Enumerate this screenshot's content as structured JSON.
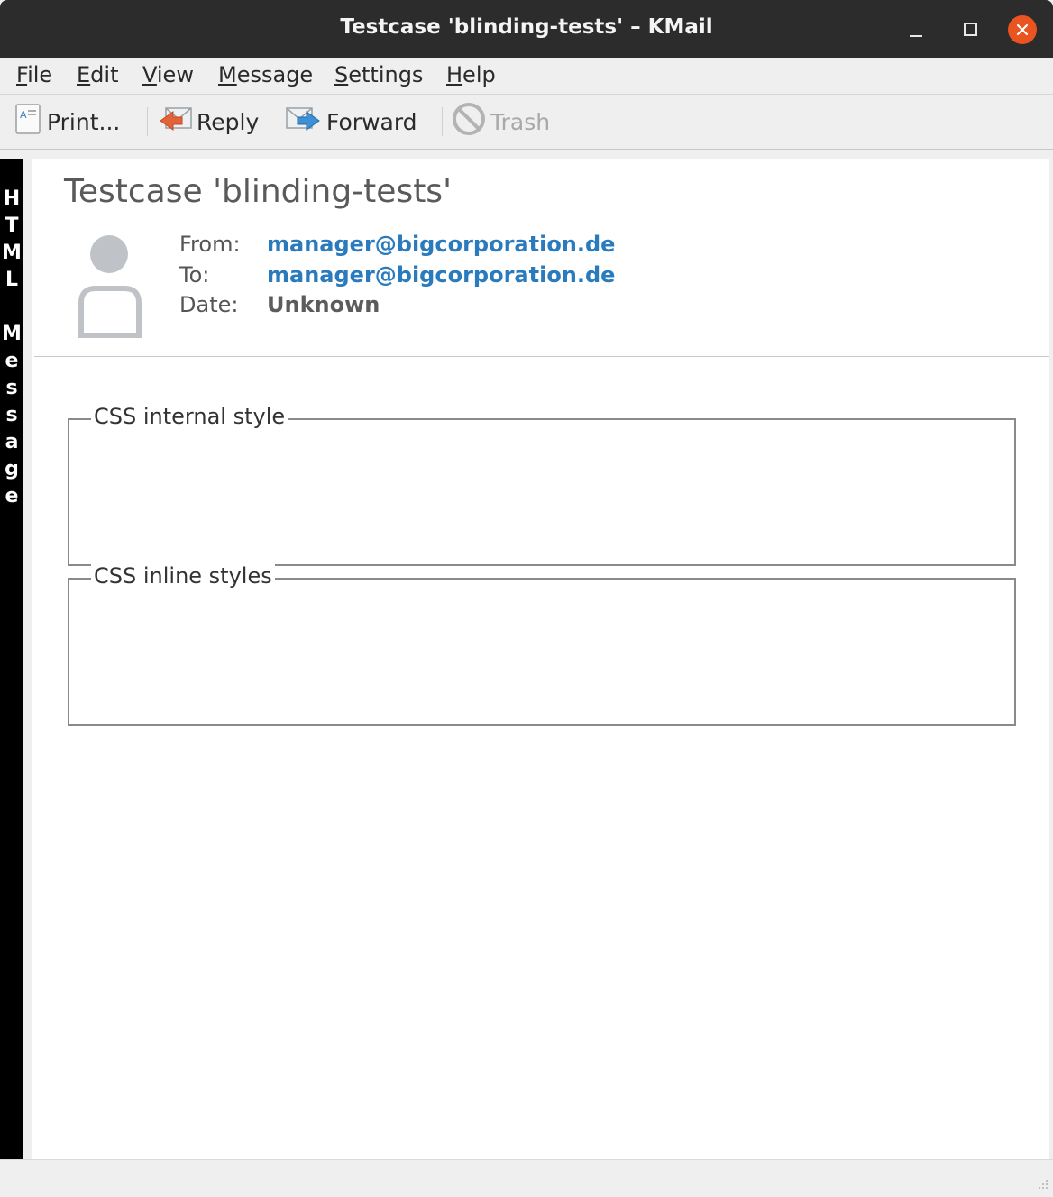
{
  "window": {
    "title": "Testcase 'blinding-tests' – KMail"
  },
  "menu": {
    "items": [
      {
        "first": "F",
        "rest": "ile"
      },
      {
        "first": "E",
        "rest": "dit"
      },
      {
        "first": "V",
        "rest": "iew"
      },
      {
        "first": "M",
        "rest": "essage"
      },
      {
        "first": "S",
        "rest": "ettings"
      },
      {
        "first": "H",
        "rest": "elp"
      }
    ]
  },
  "toolbar": {
    "print_label": "Print...",
    "reply_label": "Reply",
    "forward_label": "Forward",
    "trash_label": "Trash"
  },
  "sidebar": {
    "letters": [
      "H",
      "T",
      "M",
      "L",
      "",
      "M",
      "e",
      "s",
      "s",
      "a",
      "g",
      "e"
    ]
  },
  "message": {
    "subject": "Testcase 'blinding-tests'",
    "from_label": "From:",
    "from_value": "manager@bigcorporation.de",
    "to_label": "To:",
    "to_value": "manager@bigcorporation.de",
    "date_label": "Date:",
    "date_value": "Unknown"
  },
  "body": {
    "fieldset1_legend": "CSS internal style",
    "fieldset2_legend": "CSS inline styles"
  },
  "colors": {
    "titlebar": "#2c2c2c",
    "close_button": "#e95420",
    "link": "#2a7bbd",
    "sidebar": "#000000"
  }
}
